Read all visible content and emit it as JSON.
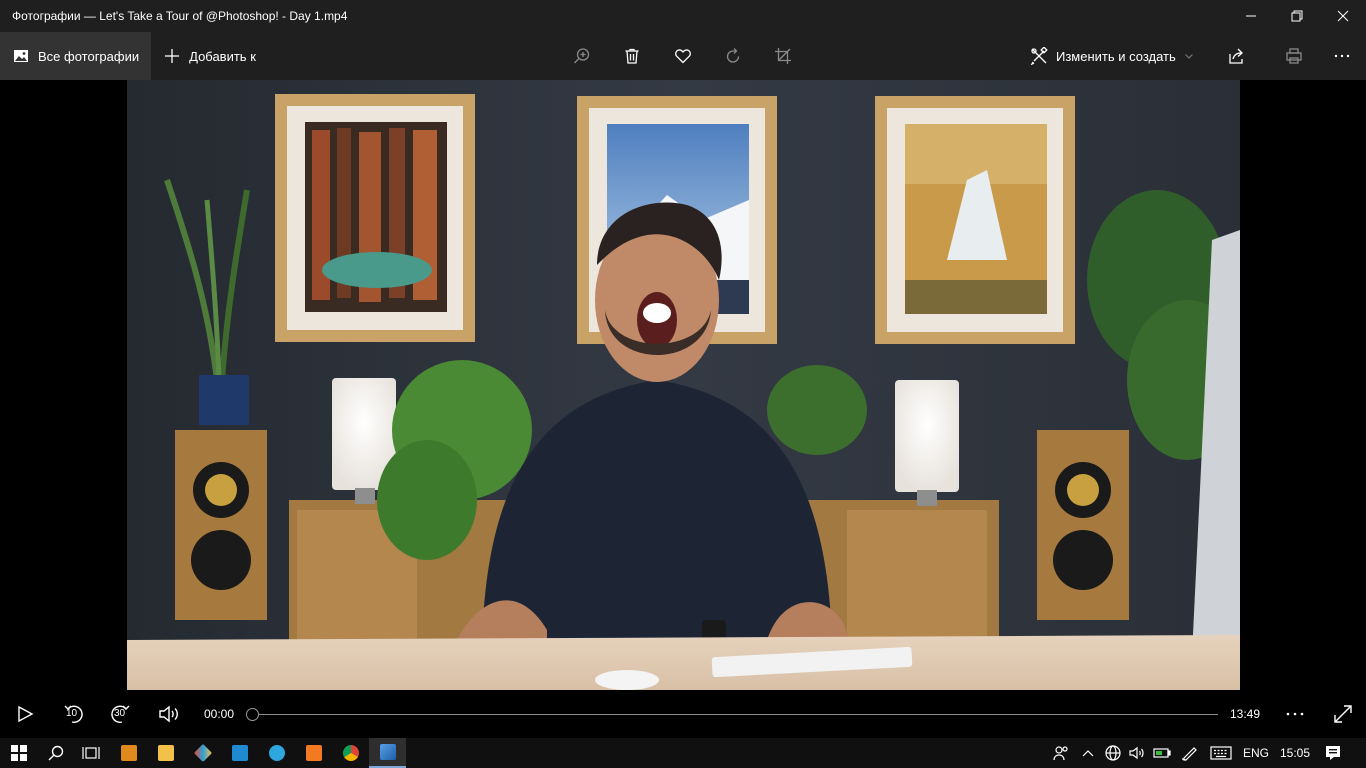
{
  "window": {
    "title": "Фотографии — Let's Take a Tour of @Photoshop! - Day 1.mp4",
    "controls": [
      "minimize-icon",
      "restore-icon",
      "close-icon"
    ]
  },
  "toolbar": {
    "all_photos_label": "Все фотографии",
    "add_to_label": "Добавить к",
    "edit_create_label": "Изменить и создать",
    "icons": [
      "zoom-in-icon",
      "delete-icon",
      "favorite-icon",
      "rotate-icon",
      "crop-icon",
      "share-icon",
      "print-icon",
      "more-icon"
    ]
  },
  "player": {
    "current_time": "00:00",
    "duration": "13:49",
    "progress": 0,
    "skip_back_seconds": "10",
    "skip_forward_seconds": "30"
  },
  "taskbar": {
    "language": "ENG",
    "clock": "15:05",
    "apps": [
      "start-icon",
      "search-icon",
      "task-view-icon",
      "sublime-text-icon",
      "file-explorer-icon",
      "git-icon",
      "vscode-icon",
      "telegram-icon",
      "xampp-icon",
      "chrome-icon",
      "photos-icon"
    ]
  },
  "colors": {
    "titlebar_bg": "#1f1f1f",
    "taskbar_bg": "#101010",
    "accent": "#7aa7d8"
  }
}
